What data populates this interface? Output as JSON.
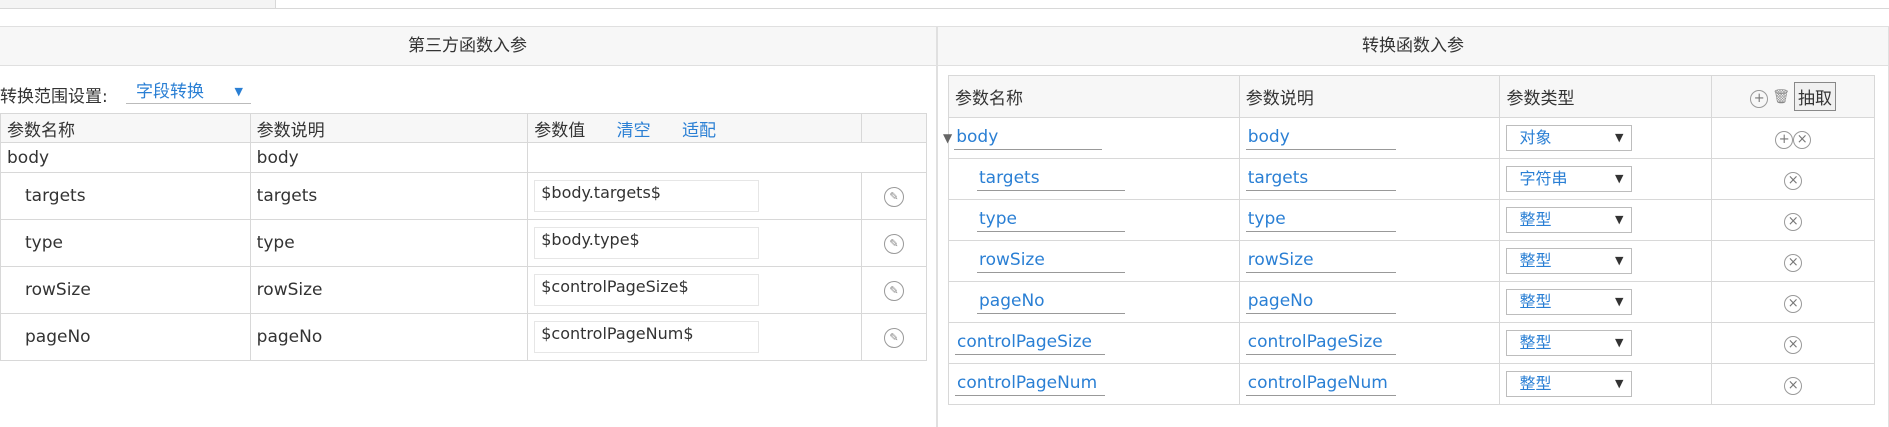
{
  "left_panel": {
    "title": "第三方函数入参",
    "range_label": "转换范围设置:",
    "range_value": "字段转换",
    "columns": [
      "参数名称",
      "参数说明",
      "参数值"
    ],
    "clear_link": "清空",
    "match_link": "适配",
    "rows": [
      {
        "name": "body",
        "desc": "body",
        "value": ""
      },
      {
        "name": "targets",
        "desc": "targets",
        "value": "$body.targets$"
      },
      {
        "name": "type",
        "desc": "type",
        "value": "$body.type$"
      },
      {
        "name": "rowSize",
        "desc": "rowSize",
        "value": "$controlPageSize$"
      },
      {
        "name": "pageNo",
        "desc": "pageNo",
        "value": "$controlPageNum$"
      }
    ]
  },
  "right_panel": {
    "title": "转换函数入参",
    "columns": [
      "参数名称",
      "参数说明",
      "参数类型"
    ],
    "extract_button": "抽取",
    "rows": [
      {
        "name": "body",
        "desc": "body",
        "type": "对象"
      },
      {
        "name": "targets",
        "desc": "targets",
        "type": "字符串"
      },
      {
        "name": "type",
        "desc": "type",
        "type": "整型"
      },
      {
        "name": "rowSize",
        "desc": "rowSize",
        "type": "整型"
      },
      {
        "name": "pageNo",
        "desc": "pageNo",
        "type": "整型"
      },
      {
        "name": "controlPageSize",
        "desc": "controlPageSize",
        "type": "整型"
      },
      {
        "name": "controlPageNum",
        "desc": "controlPageNum",
        "type": "整型"
      }
    ]
  },
  "icons": {
    "edit": "pencil-circle-icon",
    "add": "plus-circle-icon",
    "remove": "x-circle-icon",
    "delete": "trash-icon",
    "expand": "triangle-down-icon",
    "dropdown": "chevron-down-icon"
  },
  "colors": {
    "link": "#2a7fd4",
    "border": "#d8d8d8",
    "header_bg": "#f7f7f7"
  }
}
